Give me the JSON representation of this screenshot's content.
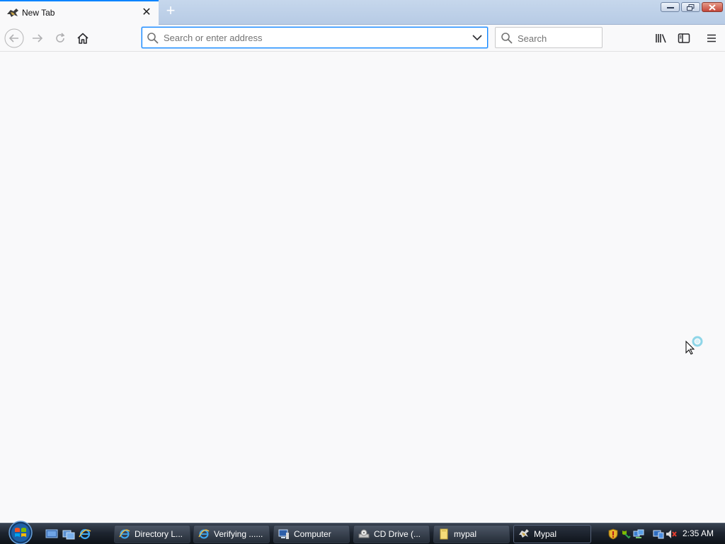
{
  "window": {
    "tab_title": "New Tab",
    "controls": {
      "minimize": "minimize",
      "restore": "restore",
      "close": "close"
    }
  },
  "toolbar": {
    "back": "back-arrow-icon",
    "forward": "forward-arrow-icon",
    "reload": "reload-icon",
    "home": "home-icon",
    "url_placeholder": "Search or enter address",
    "url_value": "",
    "search_placeholder": "Search",
    "library": "library-icon",
    "sidebar": "sidebar-icon",
    "menu": "hamburger-menu-icon"
  },
  "colors": {
    "accent": "#0a84ff",
    "content_bg": "#f9f9fa"
  },
  "taskbar": {
    "tasks": [
      {
        "label": "Directory L...",
        "icon": "ie-icon"
      },
      {
        "label": "Verifying ......",
        "icon": "ie-icon"
      },
      {
        "label": "Computer",
        "icon": "computer-icon"
      },
      {
        "label": "CD Drive (...",
        "icon": "cd-drive-icon"
      },
      {
        "label": "mypal",
        "icon": "folder-icon"
      },
      {
        "label": "Mypal",
        "icon": "mypal-icon",
        "active": true
      }
    ],
    "clock": "2:35 AM"
  }
}
